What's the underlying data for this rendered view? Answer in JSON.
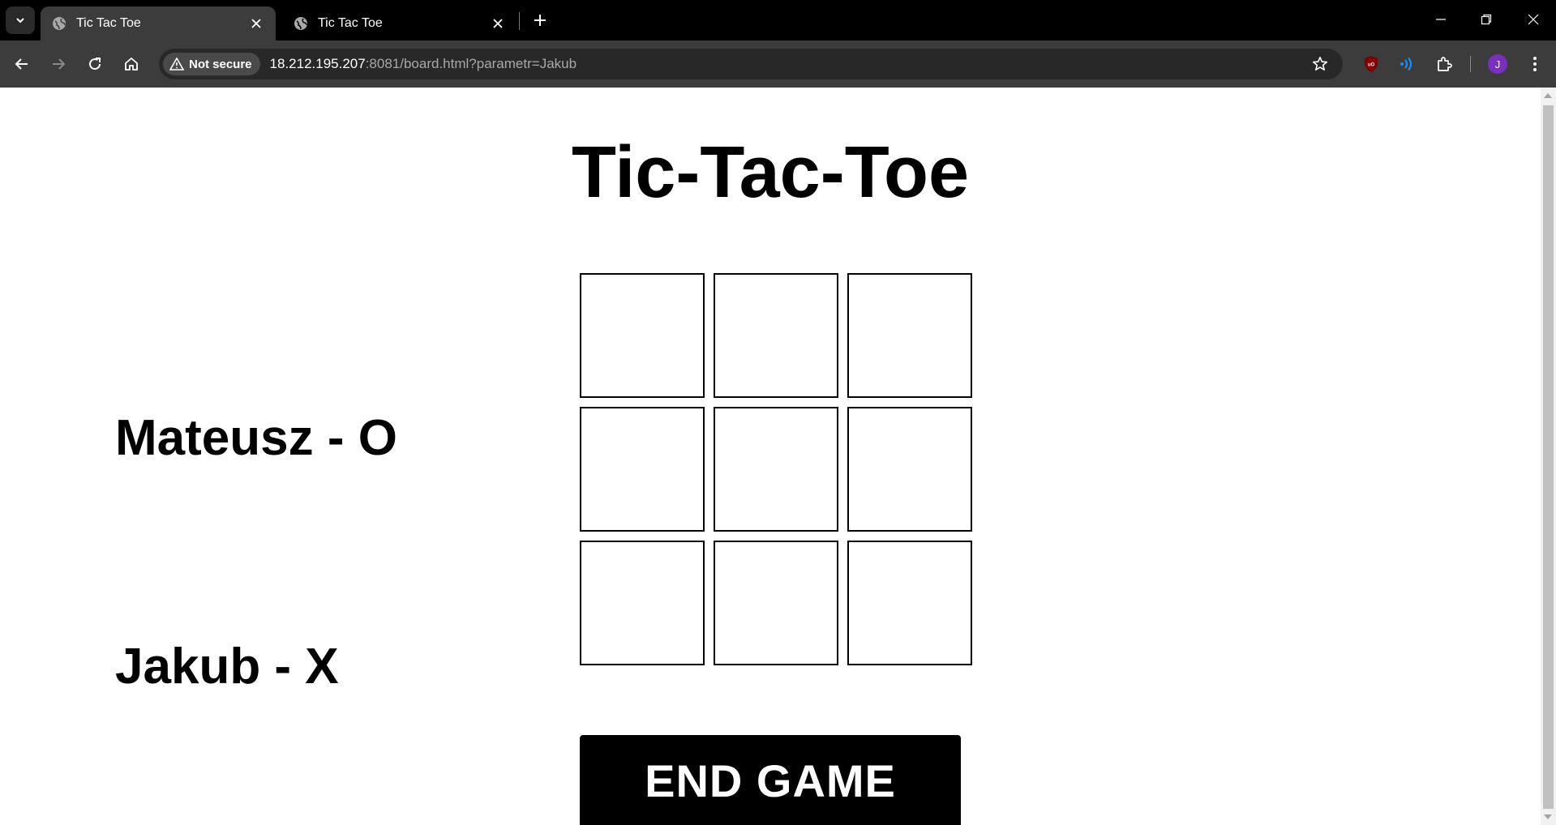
{
  "browser": {
    "tabs": [
      {
        "title": "Tic Tac Toe",
        "active": true
      },
      {
        "title": "Tic Tac Toe",
        "active": false
      }
    ],
    "security_label": "Not secure",
    "url_host": "18.212.195.207",
    "url_rest": ":8081/board.html?parametr=Jakub",
    "profile_initial": "J",
    "colors": {
      "tabbar": "#000000",
      "toolbar": "#3c3c3c",
      "omnibox": "#282828",
      "avatar": "#7b2fbf",
      "ublock": "#800000",
      "ext_blue": "#1a8cff"
    }
  },
  "page": {
    "title": "Tic-Tac-Toe",
    "players": [
      {
        "label": "Mateusz - O"
      },
      {
        "label": "Jakub - X"
      }
    ],
    "board": [
      "",
      "",
      "",
      "",
      "",
      "",
      "",
      "",
      ""
    ],
    "end_button_label": "END GAME"
  }
}
